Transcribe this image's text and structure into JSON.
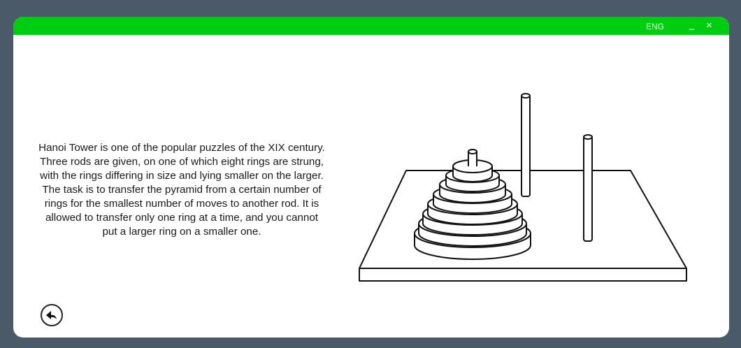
{
  "titlebar": {
    "language": "ENG",
    "minimize_label": "_",
    "close_label": "×",
    "accent_color": "#00cc12"
  },
  "main": {
    "description": "Hanoi Tower is one of the popular puzzles of the XIX century. Three rods are given, on one of which eight rings are strung, with the rings differing in size and lying smaller on the larger. The task is to transfer the pyramid from a certain number of rings for the smallest number of moves to another rod. It is allowed to transfer only one ring at a time, and you cannot put a larger ring on a smaller one.",
    "illustration": "tower-of-hanoi-drawing",
    "back_icon": "back-arrow-icon"
  }
}
